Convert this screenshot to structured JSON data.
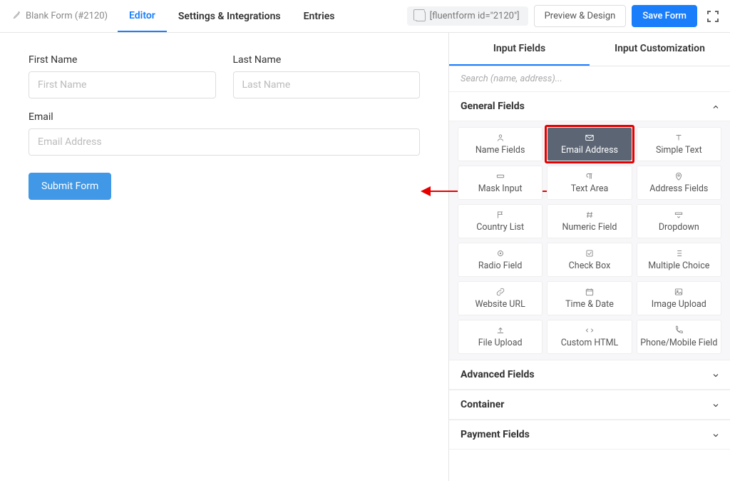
{
  "header": {
    "form_name": "Blank Form (#2120)",
    "tabs": {
      "editor": "Editor",
      "settings": "Settings & Integrations",
      "entries": "Entries"
    },
    "shortcode": "[fluentform id=\"2120\"]",
    "preview_btn": "Preview & Design",
    "save_btn": "Save Form"
  },
  "canvas": {
    "first_name_label": "First Name",
    "first_name_ph": "First Name",
    "last_name_label": "Last Name",
    "last_name_ph": "Last Name",
    "email_label": "Email",
    "email_ph": "Email Address",
    "submit_label": "Submit Form"
  },
  "panel": {
    "tab_fields": "Input Fields",
    "tab_custom": "Input Customization",
    "search_ph": "Search (name, address)...",
    "section_general": "General Fields",
    "section_advanced": "Advanced Fields",
    "section_container": "Container",
    "section_payment": "Payment Fields",
    "cards": {
      "name": "Name Fields",
      "email": "Email Address",
      "text": "Simple Text",
      "mask": "Mask Input",
      "textarea": "Text Area",
      "address": "Address Fields",
      "country": "Country List",
      "numeric": "Numeric Field",
      "dropdown": "Dropdown",
      "radio": "Radio Field",
      "checkbox": "Check Box",
      "multi": "Multiple Choice",
      "url": "Website URL",
      "date": "Time & Date",
      "image": "Image Upload",
      "file": "File Upload",
      "html": "Custom HTML",
      "phone": "Phone/Mobile Field"
    }
  }
}
